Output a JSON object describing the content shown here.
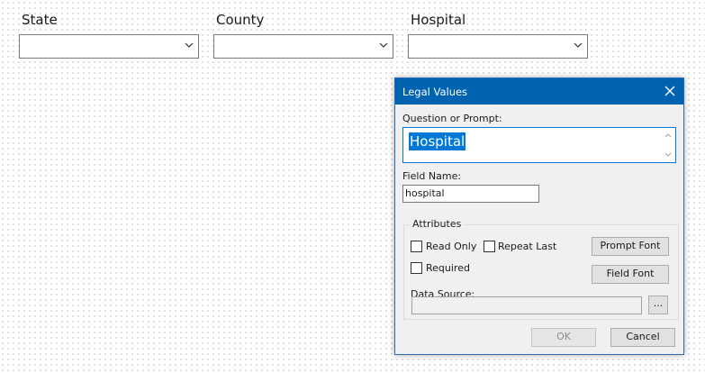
{
  "form": {
    "fields": [
      {
        "label": "State",
        "value": ""
      },
      {
        "label": "County",
        "value": ""
      },
      {
        "label": "Hospital",
        "value": ""
      }
    ]
  },
  "dialog": {
    "title": "Legal Values",
    "prompt_label": "Question or Prompt:",
    "prompt_value": "Hospital",
    "field_name_label": "Field Name:",
    "field_name_value": "hospital",
    "attributes_label": "Attributes",
    "read_only_label": "Read Only",
    "repeat_last_label": "Repeat Last",
    "required_label": "Required",
    "prompt_font_label": "Prompt Font",
    "field_font_label": "Field Font",
    "data_source_label": "Data Source:",
    "browse_label": "...",
    "ok_label": "OK",
    "cancel_label": "Cancel"
  },
  "colors": {
    "title_bar": "#0063b1",
    "selection": "#0078d7"
  }
}
